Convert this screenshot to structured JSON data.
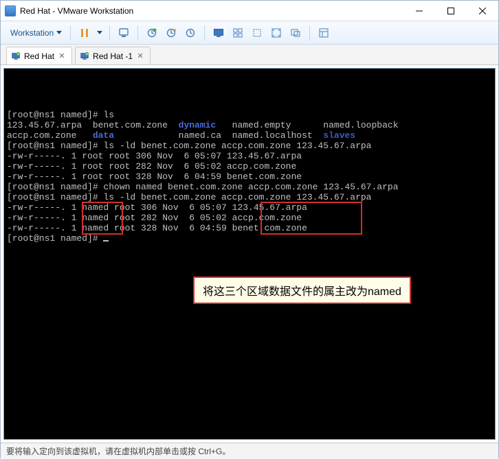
{
  "window": {
    "title": "Red Hat  - VMware Workstation"
  },
  "toolbar": {
    "menu_label": "Workstation"
  },
  "tabs": [
    {
      "label": "Red Hat",
      "active": true
    },
    {
      "label": "Red Hat -1",
      "active": false
    }
  ],
  "terminal": {
    "lines": [
      {
        "segs": [
          {
            "t": "[root@ns1 named]# ls"
          }
        ]
      },
      {
        "segs": [
          {
            "t": "123.45.67.arpa  benet.com.zone  "
          },
          {
            "t": "dynamic",
            "c": "term-blue"
          },
          {
            "t": "   named.empty      named.loopback"
          }
        ]
      },
      {
        "segs": [
          {
            "t": "accp.com.zone   "
          },
          {
            "t": "data",
            "c": "term-blue"
          },
          {
            "t": "            named.ca  named.localhost  "
          },
          {
            "t": "slaves",
            "c": "term-blue2"
          }
        ]
      },
      {
        "segs": [
          {
            "t": "[root@ns1 named]# ls -ld benet.com.zone accp.com.zone 123.45.67.arpa"
          }
        ]
      },
      {
        "segs": [
          {
            "t": "-rw-r-----. 1 root root 306 Nov  6 05:07 123.45.67.arpa"
          }
        ]
      },
      {
        "segs": [
          {
            "t": "-rw-r-----. 1 root root 282 Nov  6 05:02 accp.com.zone"
          }
        ]
      },
      {
        "segs": [
          {
            "t": "-rw-r-----. 1 root root 328 Nov  6 04:59 benet.com.zone"
          }
        ]
      },
      {
        "segs": [
          {
            "t": "[root@ns1 named]# chown named benet.com.zone accp.com.zone 123.45.67.arpa"
          }
        ]
      },
      {
        "segs": [
          {
            "t": "[root@ns1 named]# ls -ld benet.com.zone accp.com.zone 123.45.67.arpa"
          }
        ]
      },
      {
        "segs": [
          {
            "t": "-rw-r-----. 1 named root 306 Nov  6 05:07 123.45.67.arpa"
          }
        ]
      },
      {
        "segs": [
          {
            "t": "-rw-r-----. 1 named root 282 Nov  6 05:02 accp.com.zone"
          }
        ]
      },
      {
        "segs": [
          {
            "t": "-rw-r-----. 1 named root 328 Nov  6 04:59 benet.com.zone"
          }
        ]
      },
      {
        "segs": [
          {
            "t": "[root@ns1 named]# "
          },
          {
            "cursor": true
          }
        ]
      }
    ]
  },
  "callout_text": "将这三个区域数据文件的属主改为named",
  "statusbar_text": "要将输入定向到该虚拟机，请在虚拟机内部单击或按 Ctrl+G。"
}
